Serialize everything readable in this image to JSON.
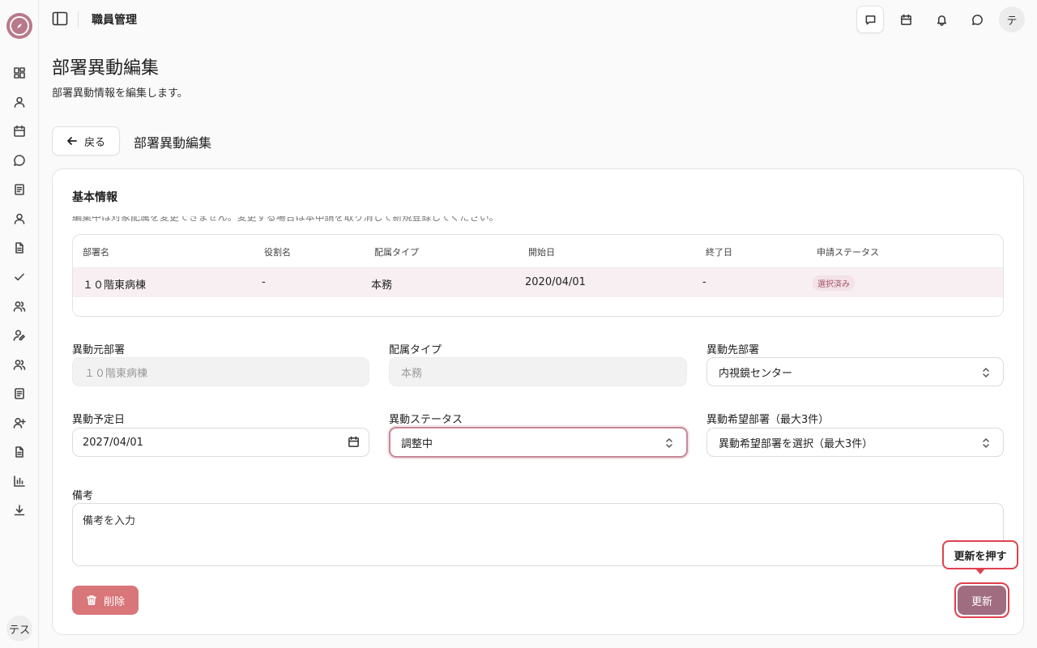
{
  "app": {
    "header_title": "職員管理",
    "user_initial": "テ",
    "sidebar_user": "テス"
  },
  "sidebar": {
    "items": [
      {
        "icon": "dashboard-icon"
      },
      {
        "icon": "user-icon"
      },
      {
        "icon": "calendar-icon"
      },
      {
        "icon": "chat-icon"
      },
      {
        "icon": "document-icon"
      },
      {
        "icon": "user-icon"
      },
      {
        "icon": "file-icon"
      },
      {
        "icon": "check-icon"
      },
      {
        "icon": "users-icon"
      },
      {
        "icon": "user-edit-icon"
      },
      {
        "icon": "users-icon"
      },
      {
        "icon": "document-icon"
      },
      {
        "icon": "user-plus-icon"
      },
      {
        "icon": "file-icon"
      },
      {
        "icon": "bar-chart-icon"
      },
      {
        "icon": "download-icon"
      }
    ]
  },
  "page": {
    "title": "部署異動編集",
    "description": "部署異動情報を編集します。",
    "back_label": "戻る",
    "sub_title": "部署異動編集"
  },
  "card": {
    "title": "基本情報",
    "note": "編集中は対象配属を変更できません。変更する場合は本申請を取り消して新規登録してください。"
  },
  "table": {
    "headers": [
      "部署名",
      "役割名",
      "配属タイプ",
      "開始日",
      "終了日",
      "申請ステータス"
    ],
    "row": {
      "department": "１０階東病棟",
      "role": "-",
      "type": "本務",
      "start": "2020/04/01",
      "end": "-",
      "status": "選択済み"
    }
  },
  "form": {
    "from_dept": {
      "label": "異動元部署",
      "value": "１０階東病棟"
    },
    "assign_type": {
      "label": "配属タイプ",
      "value": "本務"
    },
    "to_dept": {
      "label": "異動先部署",
      "value": "内視鏡センター"
    },
    "date": {
      "label": "異動予定日",
      "value": "2027/04/01"
    },
    "status": {
      "label": "異動ステータス",
      "value": "調整中"
    },
    "wish": {
      "label": "異動希望部署（最大3件）",
      "value": "異動希望部署を選択（最大3件）"
    },
    "remarks": {
      "label": "備考",
      "placeholder": "備考を入力"
    }
  },
  "actions": {
    "delete_label": "削除",
    "update_label": "更新",
    "tooltip": "更新を押す"
  },
  "colors": {
    "accent": "#a06c80",
    "delete": "#d9767a",
    "highlight": "#e0414f"
  }
}
